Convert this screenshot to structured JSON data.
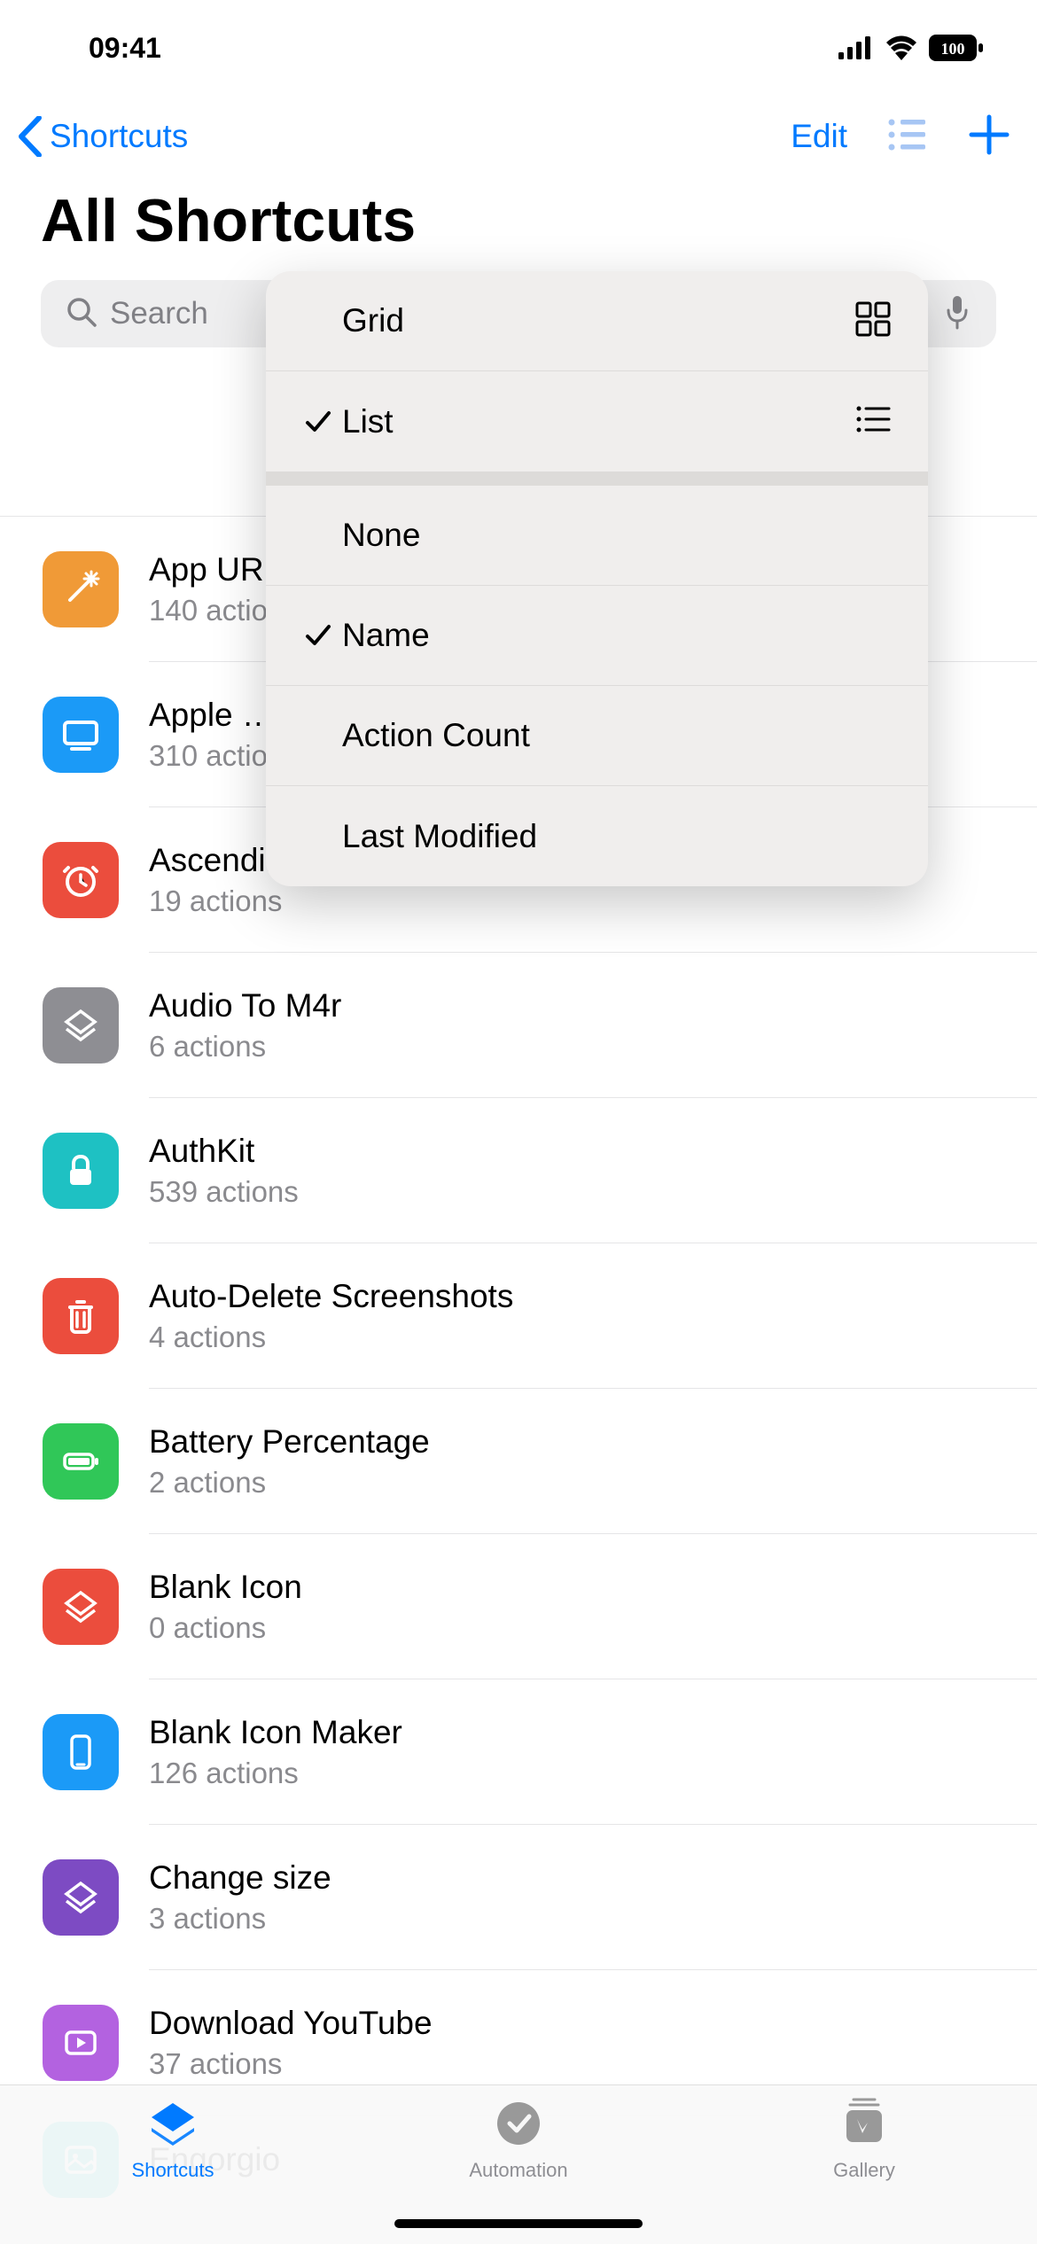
{
  "status": {
    "time": "09:41",
    "battery": "100"
  },
  "nav": {
    "back_label": "Shortcuts",
    "edit_label": "Edit",
    "title": "All Shortcuts"
  },
  "search": {
    "placeholder": "Search"
  },
  "menu": {
    "view": {
      "grid": "Grid",
      "list": "List",
      "selected": "list"
    },
    "sort": {
      "none": "None",
      "name": "Name",
      "action_count": "Action Count",
      "last_modified": "Last Modified",
      "selected": "name"
    }
  },
  "shortcuts": [
    {
      "name": "App UR…",
      "subtitle": "140 actions",
      "color": "#F09A37"
    },
    {
      "name": "Apple …",
      "subtitle": "310 actions",
      "color": "#1B9AF7"
    },
    {
      "name": "Ascending Song Alarm",
      "subtitle": "19 actions",
      "color": "#EB4D3D"
    },
    {
      "name": "Audio To M4r",
      "subtitle": "6 actions",
      "color": "#8E8E93"
    },
    {
      "name": "AuthKit",
      "subtitle": "539 actions",
      "color": "#1EC1C3"
    },
    {
      "name": "Auto-Delete Screenshots",
      "subtitle": "4 actions",
      "color": "#EB4D3D"
    },
    {
      "name": "Battery Percentage",
      "subtitle": "2 actions",
      "color": "#30C758"
    },
    {
      "name": "Blank Icon",
      "subtitle": "0 actions",
      "color": "#EB4D3D"
    },
    {
      "name": "Blank Icon Maker",
      "subtitle": "126 actions",
      "color": "#1B9AF7"
    },
    {
      "name": "Change size",
      "subtitle": "3 actions",
      "color": "#7D4BC3"
    },
    {
      "name": "Download YouTube",
      "subtitle": "37 actions",
      "color": "#B362E0"
    },
    {
      "name": "Engorgio",
      "subtitle": "",
      "color": "#1EC1C3"
    }
  ],
  "tabs": {
    "shortcuts": "Shortcuts",
    "automation": "Automation",
    "gallery": "Gallery"
  }
}
